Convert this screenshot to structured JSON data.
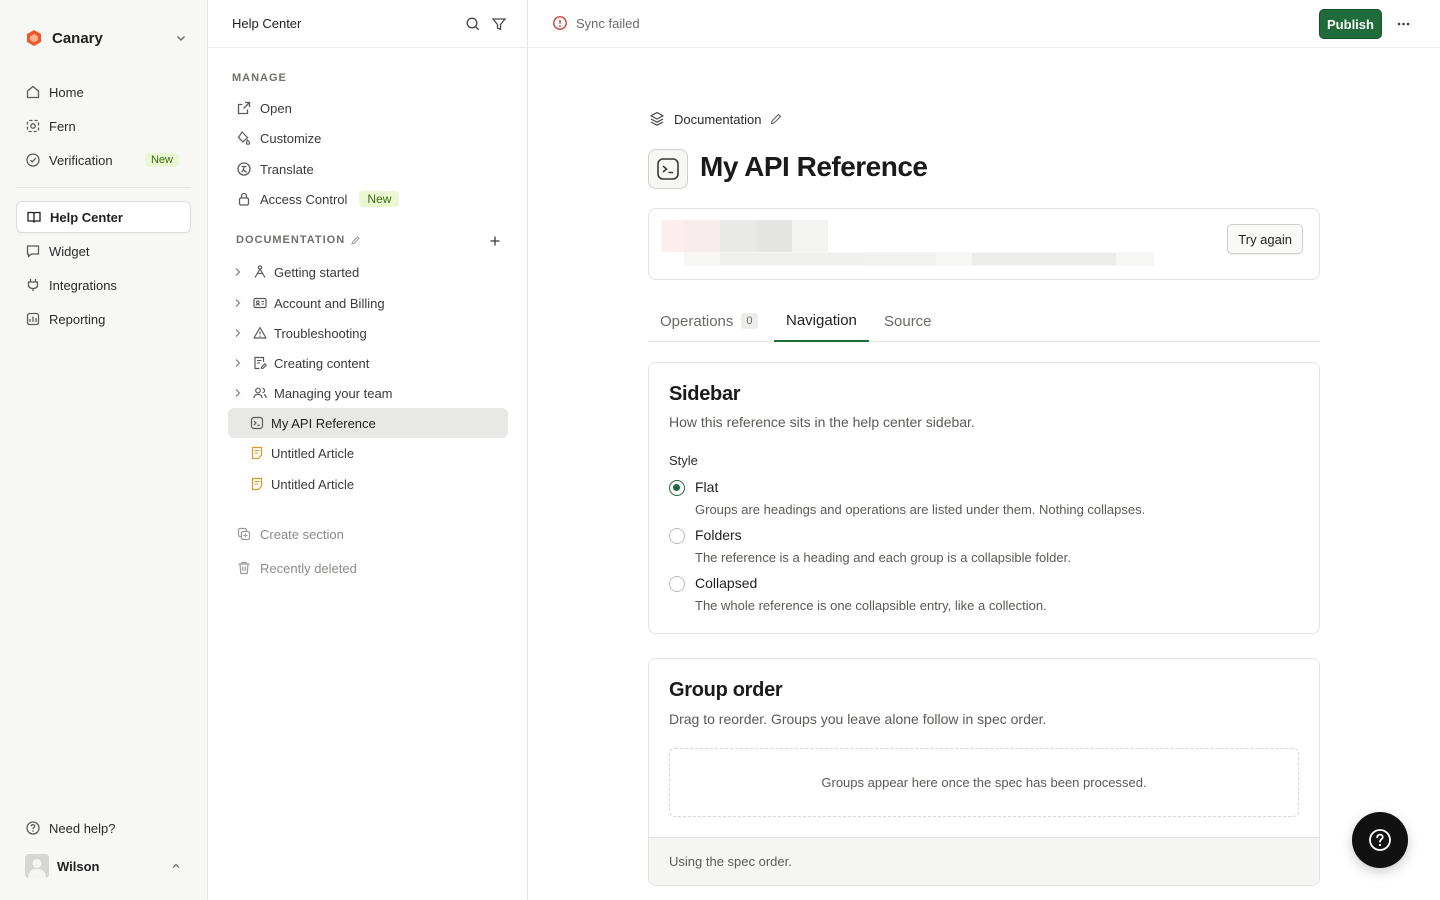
{
  "workspace": {
    "name": "Canary",
    "brand_color": "#f0592a"
  },
  "app_nav": {
    "items": [
      {
        "label": "Home",
        "icon": "home-icon"
      },
      {
        "label": "Fern",
        "icon": "fern-icon"
      },
      {
        "label": "Verification",
        "icon": "check-circle-icon",
        "badge": "New"
      },
      {
        "label": "Help Center",
        "icon": "book-icon",
        "active": true
      },
      {
        "label": "Widget",
        "icon": "chat-icon"
      },
      {
        "label": "Integrations",
        "icon": "plug-icon"
      },
      {
        "label": "Reporting",
        "icon": "chart-icon"
      }
    ],
    "need_help": "Need help?",
    "user": {
      "name": "Wilson"
    }
  },
  "help_center": {
    "title": "Help Center",
    "manage_label": "MANAGE",
    "manage_items": [
      {
        "label": "Open",
        "icon": "external-link-icon"
      },
      {
        "label": "Customize",
        "icon": "paint-icon"
      },
      {
        "label": "Translate",
        "icon": "translate-icon"
      },
      {
        "label": "Access Control",
        "icon": "lock-icon",
        "badge": "New"
      }
    ],
    "documentation_label": "DOCUMENTATION",
    "doc_items": [
      {
        "label": "Getting started",
        "icon": "path-icon"
      },
      {
        "label": "Account and Billing",
        "icon": "id-card-icon"
      },
      {
        "label": "Troubleshooting",
        "icon": "warning-icon"
      },
      {
        "label": "Creating content",
        "icon": "document-edit-icon"
      },
      {
        "label": "Managing your team",
        "icon": "users-icon"
      },
      {
        "label": "My API Reference",
        "icon": "terminal-icon",
        "active": true
      },
      {
        "label": "Untitled Article",
        "icon": "article-icon"
      },
      {
        "label": "Untitled Article",
        "icon": "article-icon"
      }
    ],
    "create_section": "Create section",
    "recently_deleted": "Recently deleted"
  },
  "topbar": {
    "status": "Sync failed",
    "publish_label": "Publish",
    "publish_color": "#1f6b3a"
  },
  "main": {
    "breadcrumb": "Documentation",
    "title": "My API Reference",
    "try_again_label": "Try again",
    "tabs": [
      {
        "label": "Operations",
        "count": "0"
      },
      {
        "label": "Navigation",
        "active": true
      },
      {
        "label": "Source"
      }
    ],
    "sidebar_card": {
      "title": "Sidebar",
      "description": "How this reference sits in the help center sidebar.",
      "style_label": "Style",
      "options": [
        {
          "label": "Flat",
          "description": "Groups are headings and operations are listed under them. Nothing collapses.",
          "selected": true
        },
        {
          "label": "Folders",
          "description": "The reference is a heading and each group is a collapsible folder.",
          "selected": false
        },
        {
          "label": "Collapsed",
          "description": "The whole reference is one collapsible entry, like a collection.",
          "selected": false
        }
      ]
    },
    "group_order_card": {
      "title": "Group order",
      "description": "Drag to reorder. Groups you leave alone follow in spec order.",
      "empty_text": "Groups appear here once the spec has been processed.",
      "footer": "Using the spec order."
    }
  }
}
